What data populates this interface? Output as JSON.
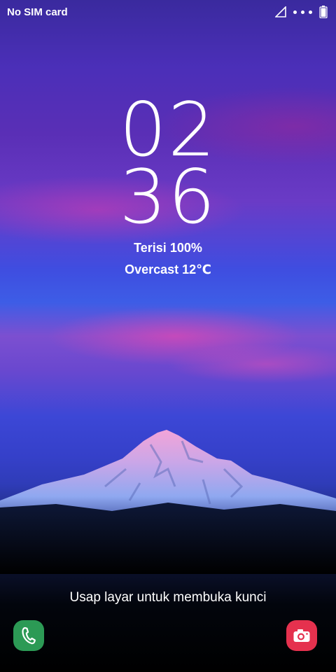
{
  "status_bar": {
    "carrier": "No SIM card",
    "icons": [
      "signal-icon",
      "more-dots-icon",
      "battery-icon"
    ]
  },
  "clock": {
    "hours": "02",
    "minutes": "36"
  },
  "lock_info": {
    "charge": "Terisi 100%",
    "weather": "Overcast 12℃"
  },
  "unlock_hint": "Usap layar untuk membuka kunci",
  "shortcuts": {
    "left": {
      "icon": "phone-icon",
      "color": "#2c9a55"
    },
    "right": {
      "icon": "camera-icon",
      "color": "#e5314e"
    }
  }
}
